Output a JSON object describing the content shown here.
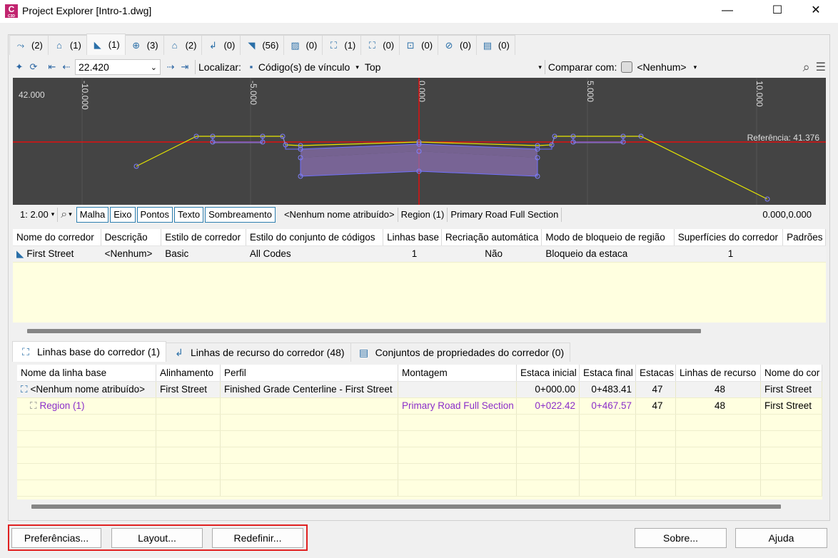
{
  "window": {
    "title": "Project Explorer [Intro-1.dwg]",
    "app_icon_letter": "C",
    "app_icon_sub": "C3D",
    "minimize": "—",
    "maximize": "☐",
    "close": "✕"
  },
  "top_tabs": [
    {
      "icon": "⤳",
      "count": "(2)"
    },
    {
      "icon": "⌂",
      "count": "(1)"
    },
    {
      "icon": "◣",
      "count": "(1)"
    },
    {
      "icon": "⊕",
      "count": "(3)"
    },
    {
      "icon": "⌂",
      "count": "(2)"
    },
    {
      "icon": "↲",
      "count": "(0)"
    },
    {
      "icon": "◥",
      "count": "(56)"
    },
    {
      "icon": "▨",
      "count": "(0)"
    },
    {
      "icon": "⛶",
      "count": "(1)"
    },
    {
      "icon": "⛶",
      "count": "(0)"
    },
    {
      "icon": "⊡",
      "count": "(0)"
    },
    {
      "icon": "⊘",
      "count": "(0)"
    },
    {
      "icon": "▤",
      "count": "(0)"
    }
  ],
  "toolbar": {
    "station_value": "22.420",
    "localizar_label": "Localizar:",
    "localizar_value": "Código(s) de vínculo",
    "localizar_top": "Top",
    "comparar_label": "Comparar com:",
    "comparar_value": "<Nenhum>"
  },
  "viewer": {
    "y_label": "42.000",
    "ticks": [
      "-10.000",
      "-5.000",
      "0.000",
      "5.000",
      "10.000"
    ],
    "reference": "Referência: 41.376"
  },
  "statusbar": {
    "scale": "1: 2.00",
    "toggles": [
      "Malha",
      "Eixo",
      "Pontos",
      "Texto",
      "Sombreamento"
    ],
    "baseline": "<Nenhum nome atribuído>",
    "region": "Region (1)",
    "assembly": "Primary Road Full Section",
    "coords": "0.000,0.000"
  },
  "corridor_grid": {
    "headers": [
      "Nome do corredor",
      "Descrição",
      "Estilo de corredor",
      "Estilo do conjunto de códigos",
      "Linhas base",
      "Recriação automática",
      "Modo de bloqueio de região",
      "Superfícies do corredor",
      "Padrões"
    ],
    "rows": [
      {
        "name": "First Street",
        "desc": "<Nenhum>",
        "style": "Basic",
        "codeset": "All Codes",
        "baselines": "1",
        "rebuild": "Não",
        "lock": "Bloqueio da estaca",
        "surfaces": "1",
        "patterns": ""
      }
    ]
  },
  "bottom_tabs": [
    {
      "icon": "⛶",
      "label": "Linhas base do corredor (1)"
    },
    {
      "icon": "↲",
      "label": "Linhas de recurso do corredor (48)"
    },
    {
      "icon": "▤",
      "label": "Conjuntos de propriedades do corredor (0)"
    }
  ],
  "baseline_grid": {
    "headers": [
      "Nome da linha base",
      "Alinhamento",
      "Perfil",
      "Montagem",
      "Estaca inicial",
      "Estaca final",
      "Estacas",
      "Linhas de recurso",
      "Nome do cor"
    ],
    "rows": [
      {
        "name": "<Nenhum nome atribuído>",
        "alignment": "First Street",
        "profile": "Finished Grade Centerline - First Street",
        "assembly": "",
        "start": "0+000.00",
        "end": "0+483.41",
        "stations": "47",
        "features": "48",
        "corridor": "First Street"
      },
      {
        "name": "Region (1)",
        "alignment": "",
        "profile": "",
        "assembly": "Primary Road Full Section",
        "start": "0+022.42",
        "end": "0+467.57",
        "stations": "47",
        "features": "48",
        "corridor": "First Street"
      }
    ]
  },
  "buttons": {
    "preferences": "Preferências...",
    "layout": "Layout...",
    "reset": "Redefinir...",
    "about": "Sobre...",
    "help": "Ajuda"
  },
  "colors": {
    "viewer_bg": "#444444",
    "reference_line": "#e01010",
    "assembly_line": "#e6e600",
    "region_fill": "#8a6fb0",
    "highlight_border": "#e02020"
  }
}
